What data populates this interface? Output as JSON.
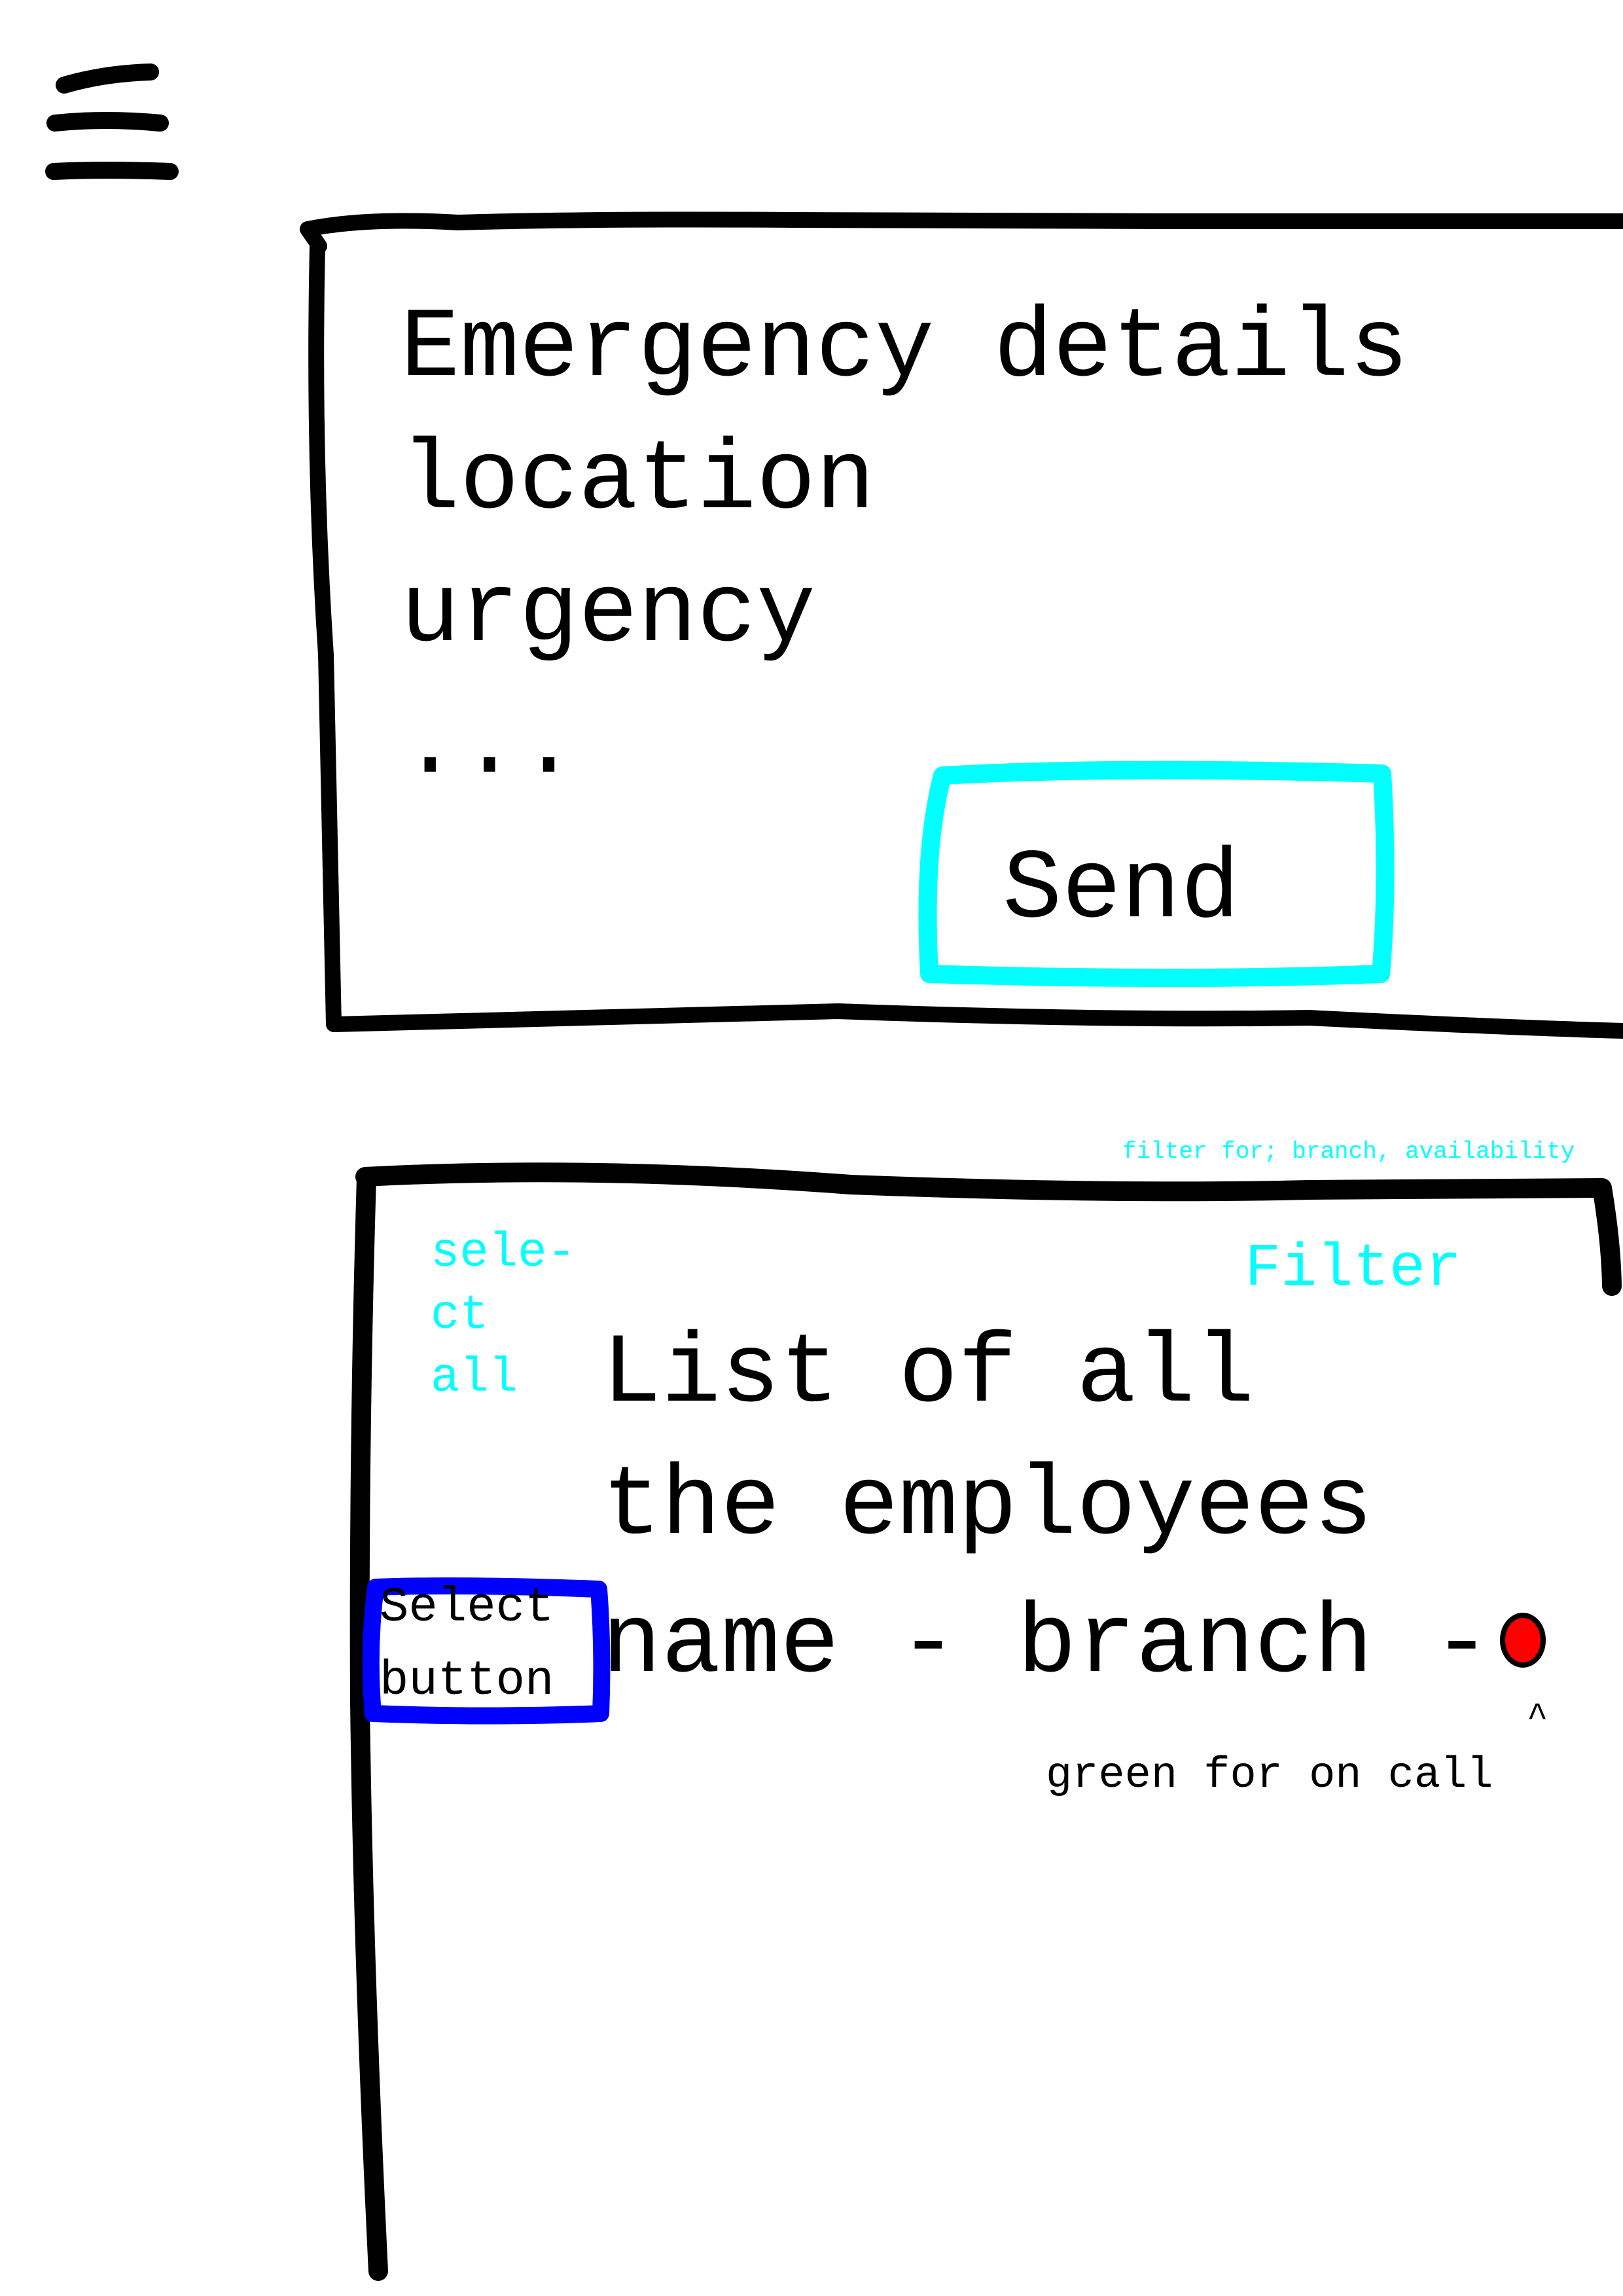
{
  "emergency": {
    "lines": [
      "Emergency details",
      "location",
      "urgency",
      "..."
    ],
    "send_label": "Send"
  },
  "employees": {
    "filter_note": "filter for; branch, availability",
    "select_all_lines": [
      "sele-",
      "ct",
      "all"
    ],
    "filter_label": "Filter",
    "title_lines": [
      "List of all",
      "the employees"
    ],
    "row_text": "name - branch -",
    "select_button_lines": [
      "Select",
      "button"
    ],
    "status_indicator_color": "#ff0000",
    "caret": "^",
    "legend": "green for on call"
  },
  "colors": {
    "ink": "#000000",
    "accent_cyan": "#00ffff",
    "select_blue": "#0000ff",
    "status_red": "#ff0000"
  }
}
